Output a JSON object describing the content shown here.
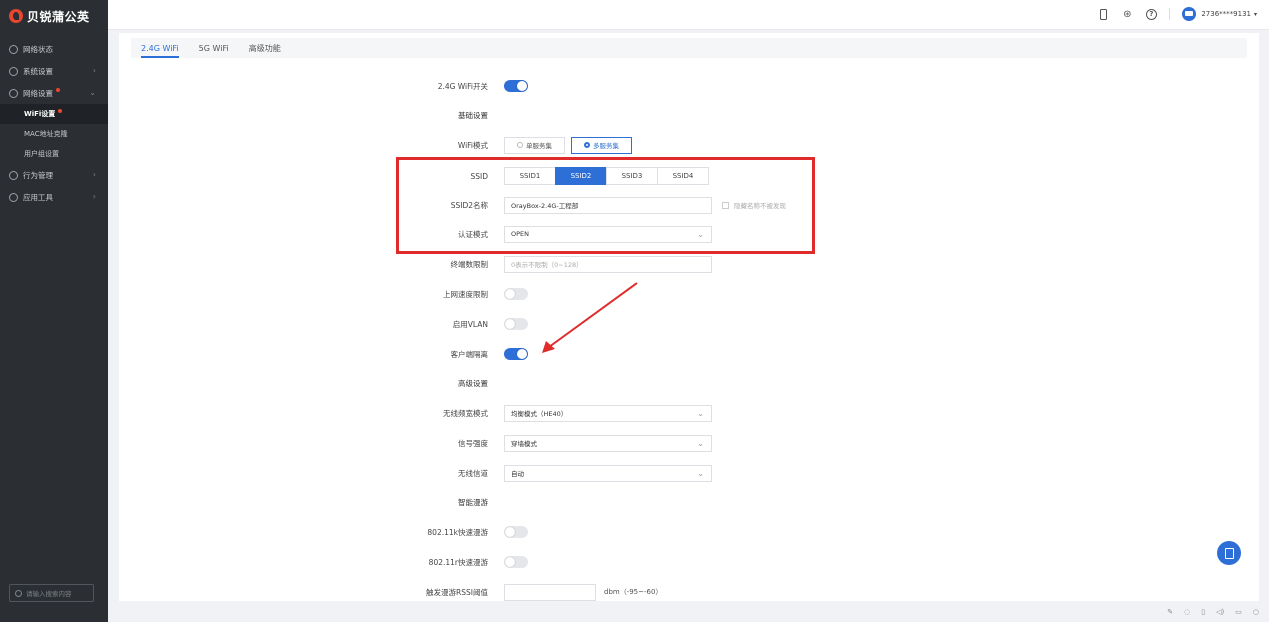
{
  "app": {
    "logo_text": "贝锐蒲公英"
  },
  "sidebar": {
    "items": [
      {
        "label": "网络状态",
        "icon": "globe-icon"
      },
      {
        "label": "系统设置",
        "icon": "settings-icon"
      },
      {
        "label": "网络设置",
        "icon": "network-icon"
      },
      {
        "label": "行为管理",
        "icon": "behavior-icon"
      },
      {
        "label": "应用工具",
        "icon": "tools-icon"
      }
    ],
    "sub_items": [
      {
        "label": "WiFi设置"
      },
      {
        "label": "MAC地址克隆"
      },
      {
        "label": "用户组设置"
      }
    ],
    "search_placeholder": "请输入搜索内容"
  },
  "header": {
    "username": "2736****9131",
    "icons": [
      "phone-icon",
      "share-icon",
      "help-icon",
      "avatar"
    ]
  },
  "tabs": [
    {
      "label": "2.4G WiFi",
      "active": true
    },
    {
      "label": "5G WiFi",
      "active": false
    },
    {
      "label": "高级功能",
      "active": false
    }
  ],
  "form": {
    "wifi_switch_label": "2.4G WiFi开关",
    "wifi_switch_on": true,
    "basic_section": "基础设置",
    "wifi_mode_label": "WiFi模式",
    "wifi_mode_single": "单服务集",
    "wifi_mode_multi": "多服务集",
    "ssid_label": "SSID",
    "ssid_options": [
      "SSID1",
      "SSID2",
      "SSID3",
      "SSID4"
    ],
    "ssid_selected": "SSID2",
    "ssid_name_label": "SSID2名称",
    "ssid_name_value": "OrayBox-2.4G-工程部",
    "hide_ssid_label": "隐藏名称不被发现",
    "auth_label": "认证模式",
    "auth_value": "OPEN",
    "client_limit_label": "终端数限制",
    "client_limit_placeholder": "0表示不限制（0~128）",
    "speed_limit_label": "上网速度限制",
    "speed_limit_on": false,
    "vlan_label": "启用VLAN",
    "vlan_on": false,
    "isolation_label": "客户端隔离",
    "isolation_on": true,
    "advanced_section": "高级设置",
    "bandwidth_label": "无线频宽模式",
    "bandwidth_value": "均衡模式（HE40）",
    "signal_label": "信号强度",
    "signal_value": "穿墙模式",
    "channel_label": "无线信道",
    "channel_value": "自动",
    "roaming_section": "智能漫游",
    "k_roaming_label": "802.11k快速漫游",
    "k_roaming_on": false,
    "r_roaming_label": "802.11r快速漫游",
    "r_roaming_on": false,
    "rssi_label": "触发漫游RSSI阈值",
    "rssi_unit": "dbm（-95~-60）"
  },
  "colors": {
    "accent": "#2d6fd6",
    "highlight_box": "#e02b2b",
    "sidebar_bg": "#2b2f33"
  }
}
